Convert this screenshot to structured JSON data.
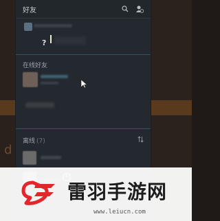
{
  "panel": {
    "title": "好友",
    "me": {
      "status_text": "?"
    },
    "online_section": {
      "title": "在线好友"
    },
    "offline_section": {
      "title": "离线",
      "count": "(7)"
    }
  },
  "icons": {
    "search": "search-icon",
    "add_friend": "add-friend-icon",
    "sort": "sort-icon",
    "clock": "clock-icon",
    "cursor": "mouse-cursor-icon"
  },
  "watermark": {
    "site_name": "雷羽手游网",
    "url": "www.leiucn.com",
    "logo_color": "#e1262c"
  },
  "colors": {
    "panel_bg": "#24292f",
    "background_accent": "#5a3a1c",
    "divider": "#2e5566"
  }
}
